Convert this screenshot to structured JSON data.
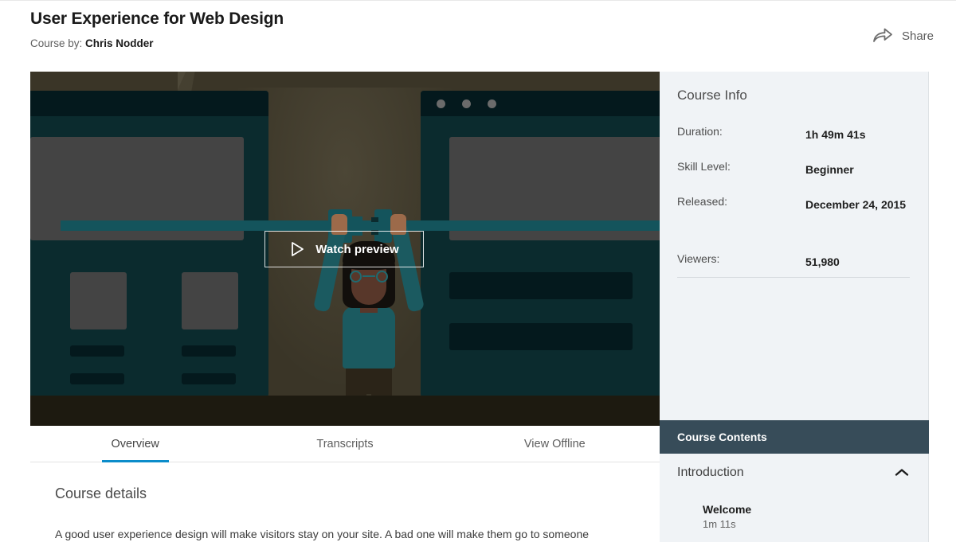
{
  "header": {
    "title": "User Experience for Web Design",
    "byline_prefix": "Course by:",
    "author": "Chris Nodder",
    "share_label": "Share",
    "share_icon": "share-arrow-icon"
  },
  "video": {
    "watch_label": "Watch preview",
    "play_icon": "play-triangle-icon",
    "illustration": "person-holding-plug-connectors-between-two-browser-windows",
    "bg_color": "#3a3527",
    "panel_color": "#0b2b2e",
    "accent_color": "#14545c"
  },
  "tabs": [
    {
      "label": "Overview",
      "active": true
    },
    {
      "label": "Transcripts",
      "active": false
    },
    {
      "label": "View Offline",
      "active": false
    }
  ],
  "tab_accent_color": "#0b8cca",
  "details": {
    "heading": "Course details",
    "paragraph": "A good user experience design will make visitors stay on your site. A bad one will make them go to someone"
  },
  "sidebar": {
    "course_info_title": "Course Info",
    "info_rows": [
      {
        "label": "Duration:",
        "value": "1h 49m 41s"
      },
      {
        "label": "Skill Level:",
        "value": "Beginner"
      },
      {
        "label": "Released:",
        "value": "December 24, 2015"
      },
      {
        "label": "Viewers:",
        "value": "51,980"
      }
    ],
    "contents_header": "Course Contents",
    "contents_header_color": "#374c59",
    "section": {
      "label": "Introduction",
      "expanded": true,
      "chevron_icon": "chevron-up-icon"
    },
    "items": [
      {
        "title": "Welcome",
        "duration": "1m 11s"
      }
    ]
  }
}
